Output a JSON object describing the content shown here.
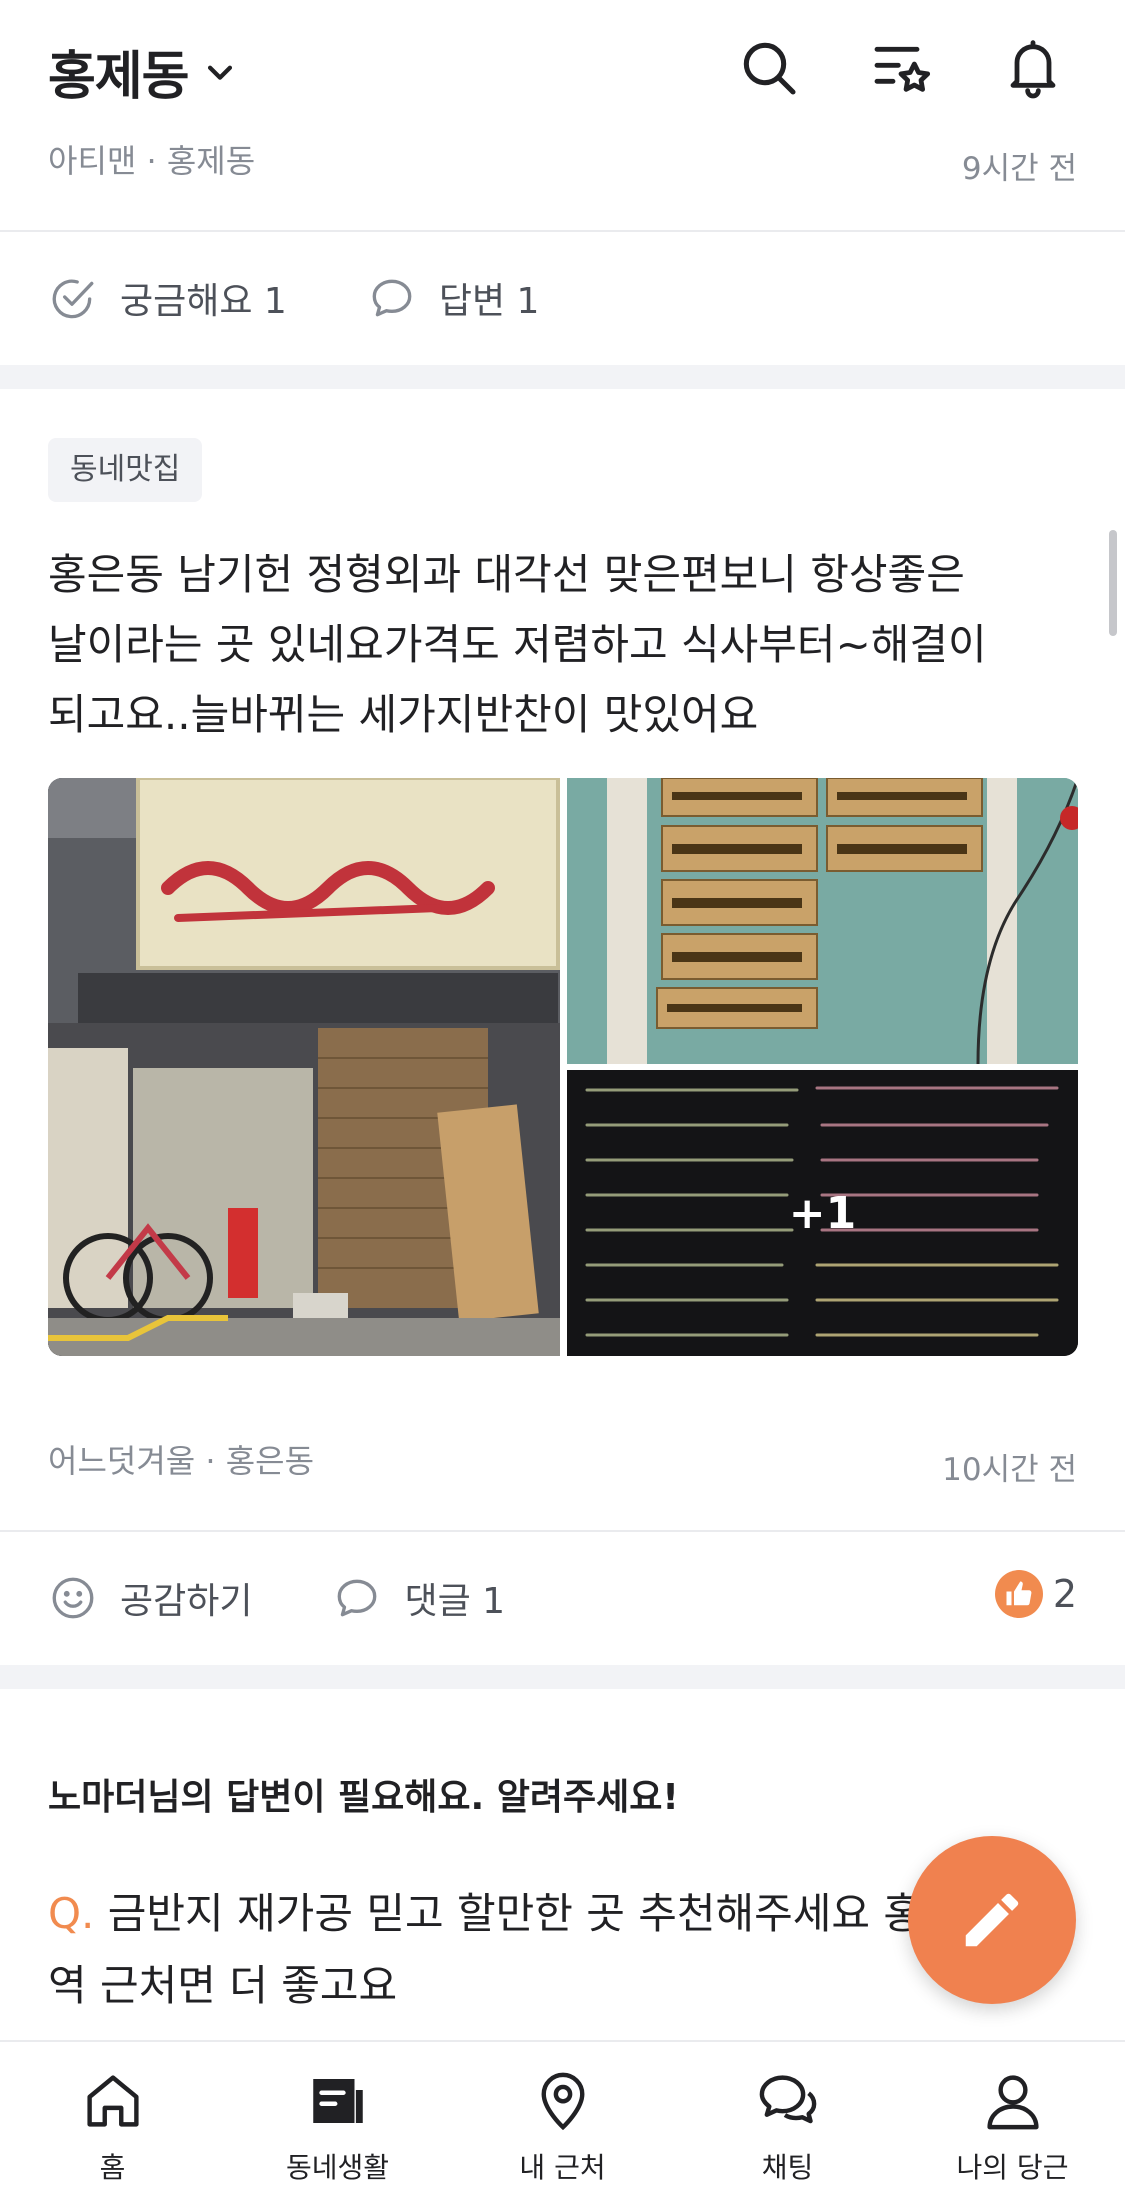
{
  "header": {
    "location": "홍제동",
    "icons": [
      "search-icon",
      "category-star-icon",
      "bell-icon"
    ]
  },
  "prev_post": {
    "author": "아티맨",
    "region": "홍제동",
    "time": "9시간 전",
    "actions": {
      "curious": "궁금해요 1",
      "answer": "답변 1"
    }
  },
  "post": {
    "tag": "동네맛집",
    "text": "홍은동 남기헌 정형외과 대각선 맞은편보니  항상좋은 날이라는 곳 있네요가격도 저렴하고  식사부터~해결이 되고요..늘바뀌는  세가지반찬이  맛있어요",
    "more_photos": "+1",
    "author": "어느덧겨울",
    "region": "홍은동",
    "time": "10시간 전",
    "actions": {
      "like": "공감하기",
      "comment": "댓글 1"
    },
    "reaction_count": "2"
  },
  "question_card": {
    "title": "노마더님의 답변이 필요해요. 알려주세요!",
    "q_prefix": "Q.",
    "q_text": " 금반지 재가공 믿고 할만한 곳 추천해주세요 홍제역 근처면 더 좋고요"
  },
  "bottom_nav": [
    {
      "label": "홈",
      "icon": "home-icon"
    },
    {
      "label": "동네생활",
      "icon": "community-icon",
      "active": true
    },
    {
      "label": "내 근처",
      "icon": "location-pin-icon"
    },
    {
      "label": "채팅",
      "icon": "chat-icon"
    },
    {
      "label": "나의 당근",
      "icon": "user-icon"
    }
  ],
  "colors": {
    "accent": "#f0814f",
    "text": "#212124",
    "muted": "#868b94",
    "divider": "#f2f3f6"
  }
}
